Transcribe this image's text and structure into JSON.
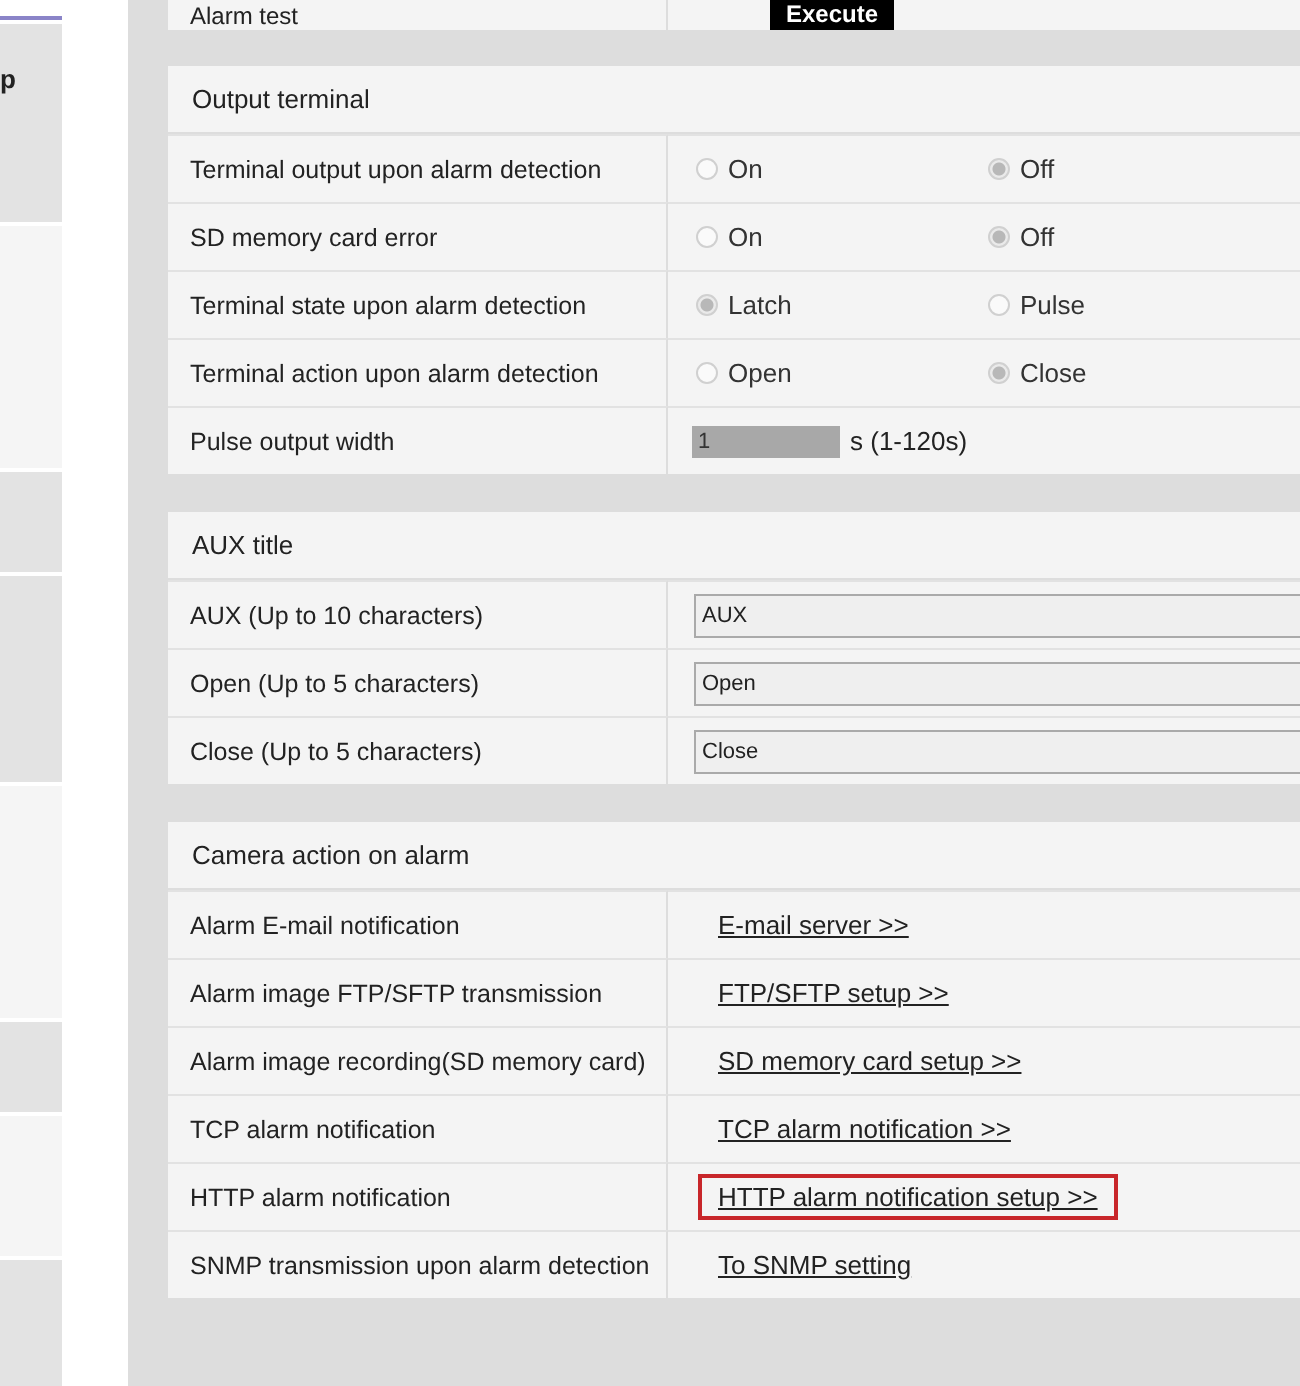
{
  "sidebar": {
    "heading": "p"
  },
  "alarm_test": {
    "label": "Alarm test",
    "button": "Execute"
  },
  "sections": [
    {
      "title": "Output terminal",
      "rows": [
        {
          "kind": "radio",
          "label": "Terminal output upon alarm detection",
          "options": [
            {
              "label": "On",
              "selected": false
            },
            {
              "label": "Off",
              "selected": true
            }
          ]
        },
        {
          "kind": "radio",
          "label": "SD memory card error",
          "options": [
            {
              "label": "On",
              "selected": false
            },
            {
              "label": "Off",
              "selected": true
            }
          ]
        },
        {
          "kind": "radio",
          "label": "Terminal state upon alarm detection",
          "options": [
            {
              "label": "Latch",
              "selected": true
            },
            {
              "label": "Pulse",
              "selected": false
            }
          ]
        },
        {
          "kind": "radio",
          "label": "Terminal action upon alarm detection",
          "options": [
            {
              "label": "Open",
              "selected": false
            },
            {
              "label": "Close",
              "selected": true
            }
          ]
        },
        {
          "kind": "number",
          "label": "Pulse output width",
          "value": "1",
          "unit": "s (1-120s)"
        }
      ]
    },
    {
      "title": "AUX title",
      "rows": [
        {
          "kind": "text",
          "label": "AUX (Up to 10 characters)",
          "value": "AUX"
        },
        {
          "kind": "text",
          "label": "Open (Up to 5 characters)",
          "value": "Open"
        },
        {
          "kind": "text",
          "label": "Close (Up to 5 characters)",
          "value": "Close"
        }
      ]
    },
    {
      "title": "Camera action on alarm",
      "rows": [
        {
          "kind": "link",
          "label": "Alarm E-mail notification",
          "link": "E-mail server >>",
          "highlighted": false
        },
        {
          "kind": "link",
          "label": "Alarm image FTP/SFTP transmission",
          "link": "FTP/SFTP setup >>",
          "highlighted": false
        },
        {
          "kind": "link",
          "label": "Alarm image recording(SD memory card)",
          "link": "SD memory card setup >>",
          "highlighted": false
        },
        {
          "kind": "link",
          "label": "TCP alarm notification",
          "link": "TCP alarm notification >>",
          "highlighted": false
        },
        {
          "kind": "link",
          "label": "HTTP alarm notification",
          "link": "HTTP alarm notification setup >>",
          "highlighted": true
        },
        {
          "kind": "link",
          "label": "SNMP transmission upon alarm detection",
          "link": "To SNMP setting",
          "highlighted": false
        }
      ]
    }
  ]
}
